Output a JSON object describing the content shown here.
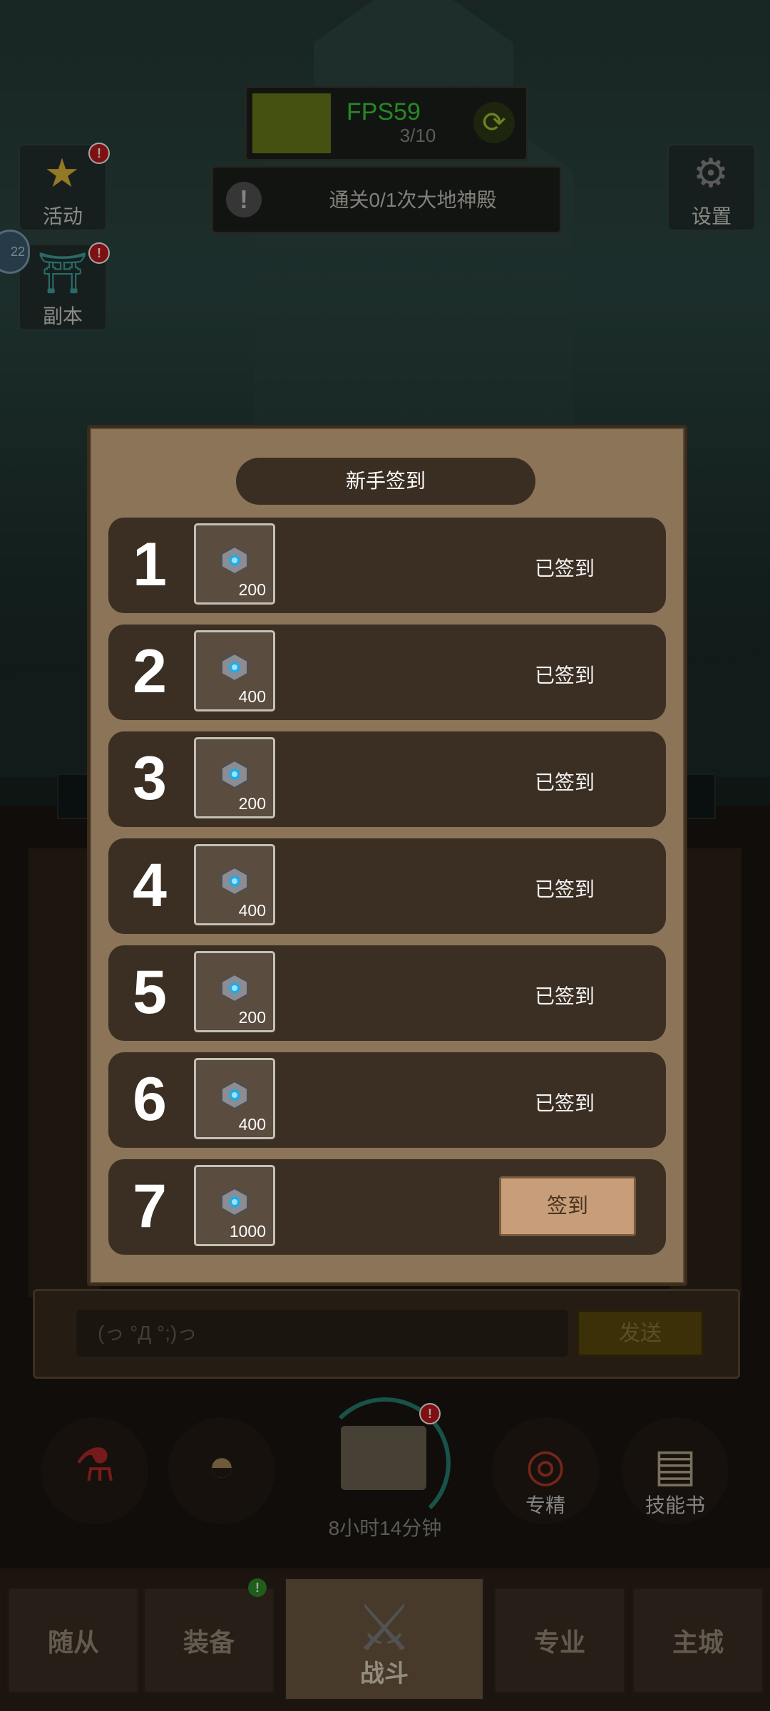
{
  "hud": {
    "quest_progress": "3/10",
    "fps": "FPS59",
    "refresh_icon": "refresh-icon",
    "task_text": "通关0/1次大地神殿"
  },
  "side_buttons": {
    "activity_label": "活动",
    "dungeon_label": "副本",
    "settings_label": "设置",
    "badge": "!",
    "level_badge": "22"
  },
  "dialog": {
    "title": "新手签到",
    "rows": [
      {
        "day": "1",
        "amount": "200",
        "status": "已签到"
      },
      {
        "day": "2",
        "amount": "400",
        "status": "已签到"
      },
      {
        "day": "3",
        "amount": "200",
        "status": "已签到"
      },
      {
        "day": "4",
        "amount": "400",
        "status": "已签到"
      },
      {
        "day": "5",
        "amount": "200",
        "status": "已签到"
      },
      {
        "day": "6",
        "amount": "400",
        "status": "已签到"
      },
      {
        "day": "7",
        "amount": "1000",
        "button": "签到"
      }
    ],
    "reward_icon": "gem-icon"
  },
  "chat": {
    "placeholder": "(っ °Д °;)っ",
    "send": "发送"
  },
  "skills": {
    "specialize": "专精",
    "skillbook": "技能书",
    "timer": "8小时14分钟",
    "badge": "!"
  },
  "nav": {
    "followers": "随从",
    "equipment": "装备",
    "battle": "战斗",
    "profession": "专业",
    "main_city": "主城",
    "equip_badge": "!"
  },
  "colors": {
    "dialog_bg": "#8b7457",
    "row_bg": "#3b2f24",
    "claim_button": "#c79e79",
    "fps_text": "#3bd13b"
  }
}
